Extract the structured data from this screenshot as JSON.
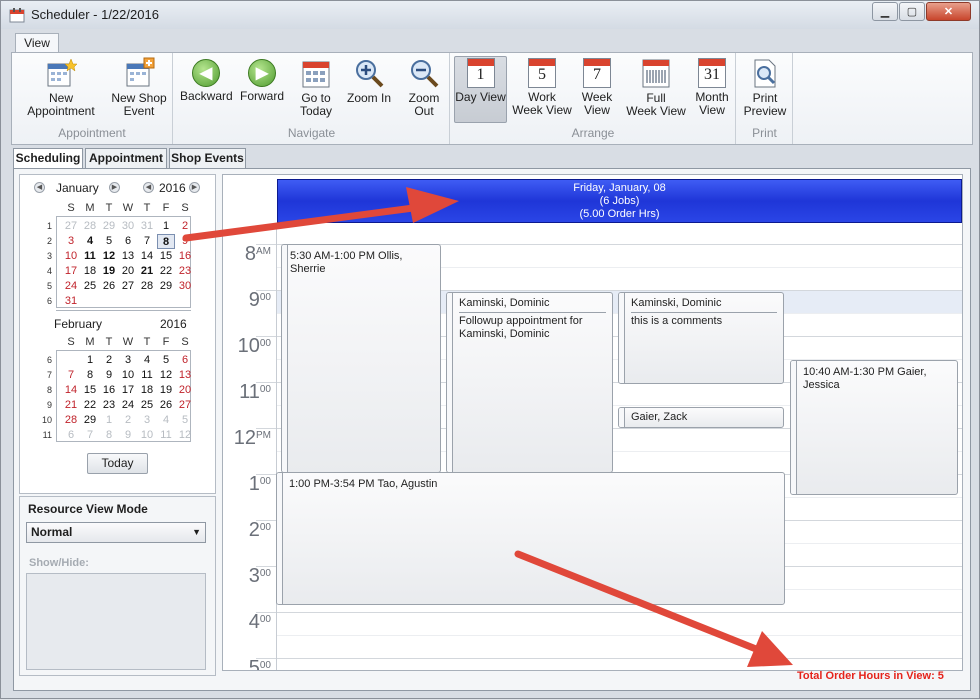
{
  "window": {
    "title": "Scheduler - 1/22/2016",
    "minimize": "▁",
    "restore": "▢",
    "close": "✕"
  },
  "ribbon": {
    "tab": "View",
    "groups": {
      "appointment": {
        "label": "Appointment",
        "new_appointment": "New Appointment",
        "new_shop_event_l1": "New Shop",
        "new_shop_event_l2": "Event"
      },
      "navigate": {
        "label": "Navigate",
        "backward": "Backward",
        "forward": "Forward",
        "go_to_today_l1": "Go to",
        "go_to_today_l2": "Today",
        "zoom_in": "Zoom In",
        "zoom_out": "Zoom Out"
      },
      "arrange": {
        "label": "Arrange",
        "day_view": "Day View",
        "day_num": "1",
        "work_week_l1": "Work",
        "work_week_l2": "Week View",
        "work_week_num": "5",
        "week_l1": "Week",
        "week_l2": "View",
        "week_num": "7",
        "full_week_l1": "Full",
        "full_week_l2": "Week View",
        "month_l1": "Month",
        "month_l2": "View",
        "month_num": "31"
      },
      "print": {
        "label": "Print",
        "print_preview_l1": "Print",
        "print_preview_l2": "Preview"
      }
    }
  },
  "tabs": {
    "scheduling": "Scheduling",
    "appointment": "Appointment",
    "shop_events": "Shop Events"
  },
  "calendar": {
    "dow": [
      "S",
      "M",
      "T",
      "W",
      "T",
      "F",
      "S"
    ],
    "january": {
      "month": "January",
      "year": "2016",
      "weeks": [
        "1",
        "2",
        "3",
        "4",
        "5",
        "6"
      ],
      "rows": [
        [
          "27",
          "28",
          "29",
          "30",
          "31",
          "1",
          "2"
        ],
        [
          "3",
          "4",
          "5",
          "6",
          "7",
          "8",
          "9"
        ],
        [
          "10",
          "11",
          "12",
          "13",
          "14",
          "15",
          "16"
        ],
        [
          "17",
          "18",
          "19",
          "20",
          "21",
          "22",
          "23"
        ],
        [
          "24",
          "25",
          "26",
          "27",
          "28",
          "29",
          "30"
        ],
        [
          "31",
          "",
          "",
          "",
          "",
          "",
          ""
        ]
      ]
    },
    "february": {
      "month": "February",
      "year": "2016",
      "weeks": [
        "6",
        "7",
        "8",
        "9",
        "10",
        "11"
      ],
      "rows": [
        [
          "",
          "1",
          "2",
          "3",
          "4",
          "5",
          "6"
        ],
        [
          "7",
          "8",
          "9",
          "10",
          "11",
          "12",
          "13"
        ],
        [
          "14",
          "15",
          "16",
          "17",
          "18",
          "19",
          "20"
        ],
        [
          "21",
          "22",
          "23",
          "24",
          "25",
          "26",
          "27"
        ],
        [
          "28",
          "29",
          "1",
          "2",
          "3",
          "4",
          "5"
        ],
        [
          "6",
          "7",
          "8",
          "9",
          "10",
          "11",
          "12"
        ]
      ]
    },
    "today_button": "Today"
  },
  "resource": {
    "title": "Resource View Mode",
    "mode": "Normal",
    "show_hide": "Show/Hide:"
  },
  "schedule": {
    "header_line1": "Friday, January, 08",
    "header_line2": "(6 Jobs)",
    "header_line3": "(5.00 Order Hrs)",
    "hours": [
      {
        "h": "8",
        "m": "AM"
      },
      {
        "h": "9",
        "m": "00"
      },
      {
        "h": "10",
        "m": "00"
      },
      {
        "h": "11",
        "m": "00"
      },
      {
        "h": "12",
        "m": "PM"
      },
      {
        "h": "1",
        "m": "00"
      },
      {
        "h": "2",
        "m": "00"
      },
      {
        "h": "3",
        "m": "00"
      },
      {
        "h": "4",
        "m": "00"
      },
      {
        "h": "5",
        "m": "00"
      }
    ],
    "appointments": {
      "ollis": "5:30 AM-1:00 PM Ollis, Sherrie",
      "kaminski1_title": "Kaminski, Dominic",
      "kaminski1_body": "Followup appointment for Kaminski, Dominic",
      "kaminski2_title": "Kaminski, Dominic",
      "kaminski2_body": "this is a comments",
      "gaier_zack": "Gaier, Zack",
      "gaier_jessica": "10:40 AM-1:30 PM Gaier, Jessica",
      "tao": "1:00 PM-3:54 PM Tao, Agustin"
    }
  },
  "footer": {
    "total_order_hours": "Total Order Hours in View: 5"
  },
  "colors": {
    "accent_red": "#e5231b",
    "header_blue": "#2a45e6",
    "weekend_red": "#c0232b"
  }
}
